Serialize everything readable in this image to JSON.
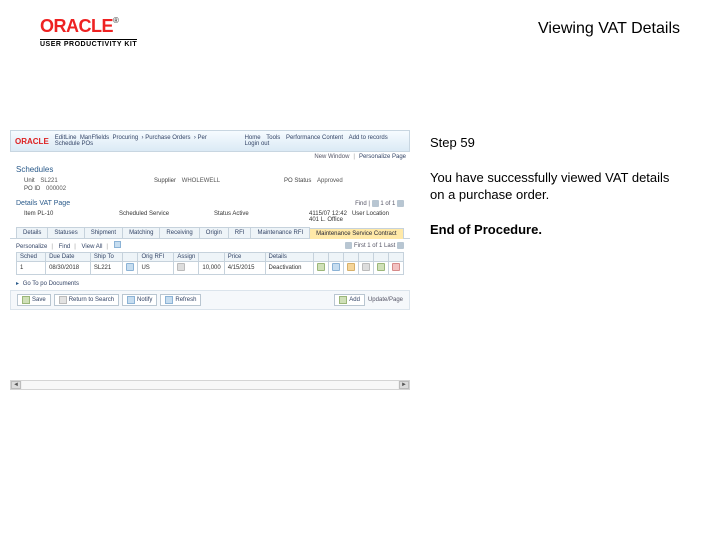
{
  "header": {
    "logo_text": "ORACLE",
    "logo_subtext": "USER PRODUCTIVITY KIT",
    "page_title": "Viewing VAT Details"
  },
  "instructions": {
    "step": "Step 59",
    "body": "You have successfully viewed VAT details on a purchase order.",
    "end": "End of Procedure."
  },
  "app": {
    "logo": "ORACLE",
    "breadcrumb": [
      "EditLine",
      "ManFfields",
      "Procuring",
      "Purchase Orders",
      "Per Schedule POs"
    ],
    "nav": [
      "Home",
      "Tools",
      "Performance Content",
      "Add to records",
      "Login out"
    ],
    "subbar": {
      "label": "New Window",
      "link": "Personalize Page"
    },
    "section": "Schedules",
    "fields": [
      {
        "lbl": "Unit",
        "val": "SL221"
      },
      {
        "lbl": "Supplier",
        "val": "WHOLEWELL"
      },
      {
        "lbl": "PO Status",
        "val": "Approved"
      },
      {
        "lbl": "PO ID",
        "val": "000002"
      }
    ],
    "detail_hd": "Details VAT Page",
    "pager": {
      "label": "Find",
      "range": "1 of 1"
    },
    "kv": [
      {
        "lbl": "Item",
        "val": "PL-10"
      },
      {
        "lbl": "Scheduled Service",
        "val": ""
      },
      {
        "lbl": "Status",
        "val": "Active"
      },
      {
        "lbl": "",
        "val": "4115/07 12:42"
      },
      {
        "lbl": "User Location",
        "val": "401 L. Office"
      }
    ],
    "tabs": [
      "Details",
      "Statuses",
      "Shipment",
      "Matching",
      "Receiving",
      "Origin",
      "RFI",
      "Maintenance RFI",
      "Maintenance Service Contract"
    ],
    "active_tab": 8,
    "toolbar": {
      "links": [
        "Personalize",
        "Find",
        "View All"
      ],
      "range": "First 1 of 1 Last"
    },
    "grid": {
      "headers": [
        "Sched",
        "Due Date",
        "Ship To",
        "",
        "Orig RFI",
        "Assign",
        "",
        "Price",
        "Details"
      ],
      "row": [
        "1",
        "08/30/2018",
        "SL221",
        "",
        "US",
        "",
        "",
        "10,000",
        "4/15/2015",
        "Deactivation"
      ]
    },
    "icon_names": [
      "edit-icon",
      "add-icon",
      "copy-icon",
      "delete-icon",
      "lookup-icon",
      "details-icon"
    ],
    "return_label": "Go To po Documents",
    "footer": {
      "buttons": [
        "Save",
        "Return to Search",
        "Notify",
        "Refresh"
      ],
      "page": "Add",
      "pagecount": "Update/Page"
    }
  }
}
